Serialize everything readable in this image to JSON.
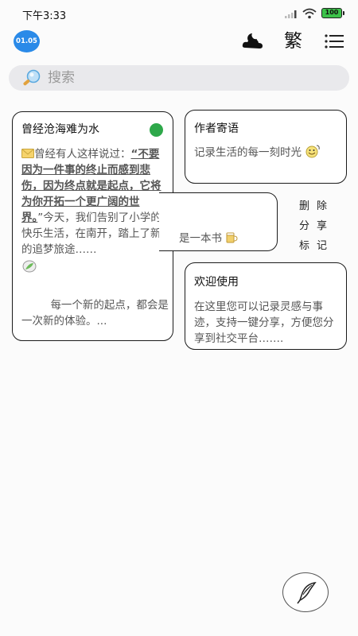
{
  "status_bar": {
    "time": "下午3:33",
    "battery": "100"
  },
  "header": {
    "date_badge": "01.05",
    "traditional_toggle": "繁"
  },
  "search": {
    "placeholder": "搜索"
  },
  "cards": [
    {
      "title": "曾经沧海难为水",
      "body_prefix": "曾经有人这样说过：",
      "body_bold": "“不要因为一件事的终止而感到悲伤，因为终点就是起点，它将为你开拓一个更广阔的世界。",
      "body_suffix": "”今天，我们告别了小学的快乐生活，在南开，踏上了新的追梦旅途……",
      "foot": "每一个新的起点，都会是一次新的体验。..."
    },
    {
      "title": "作者寄语",
      "text": "记录生活的每一刻时光"
    },
    {
      "text": "是一本书"
    },
    {
      "title": "欢迎使用",
      "text": "在这里您可以记录灵感与事迹，支持一键分享，方便您分享到社交平台……."
    }
  ],
  "swipe_actions": [
    "删除",
    "分享",
    "标记"
  ],
  "colors": {
    "accent": "#2a8ae8",
    "status_dot": "#2ea84a",
    "search_bg": "#e9e9ec"
  },
  "icons": [
    "signal-icon",
    "wifi-icon",
    "battery-icon",
    "weather-icon",
    "menu-icon",
    "search-icon",
    "envelope-icon",
    "leaf-icon",
    "face-icon",
    "cup-icon",
    "quill-icon"
  ]
}
